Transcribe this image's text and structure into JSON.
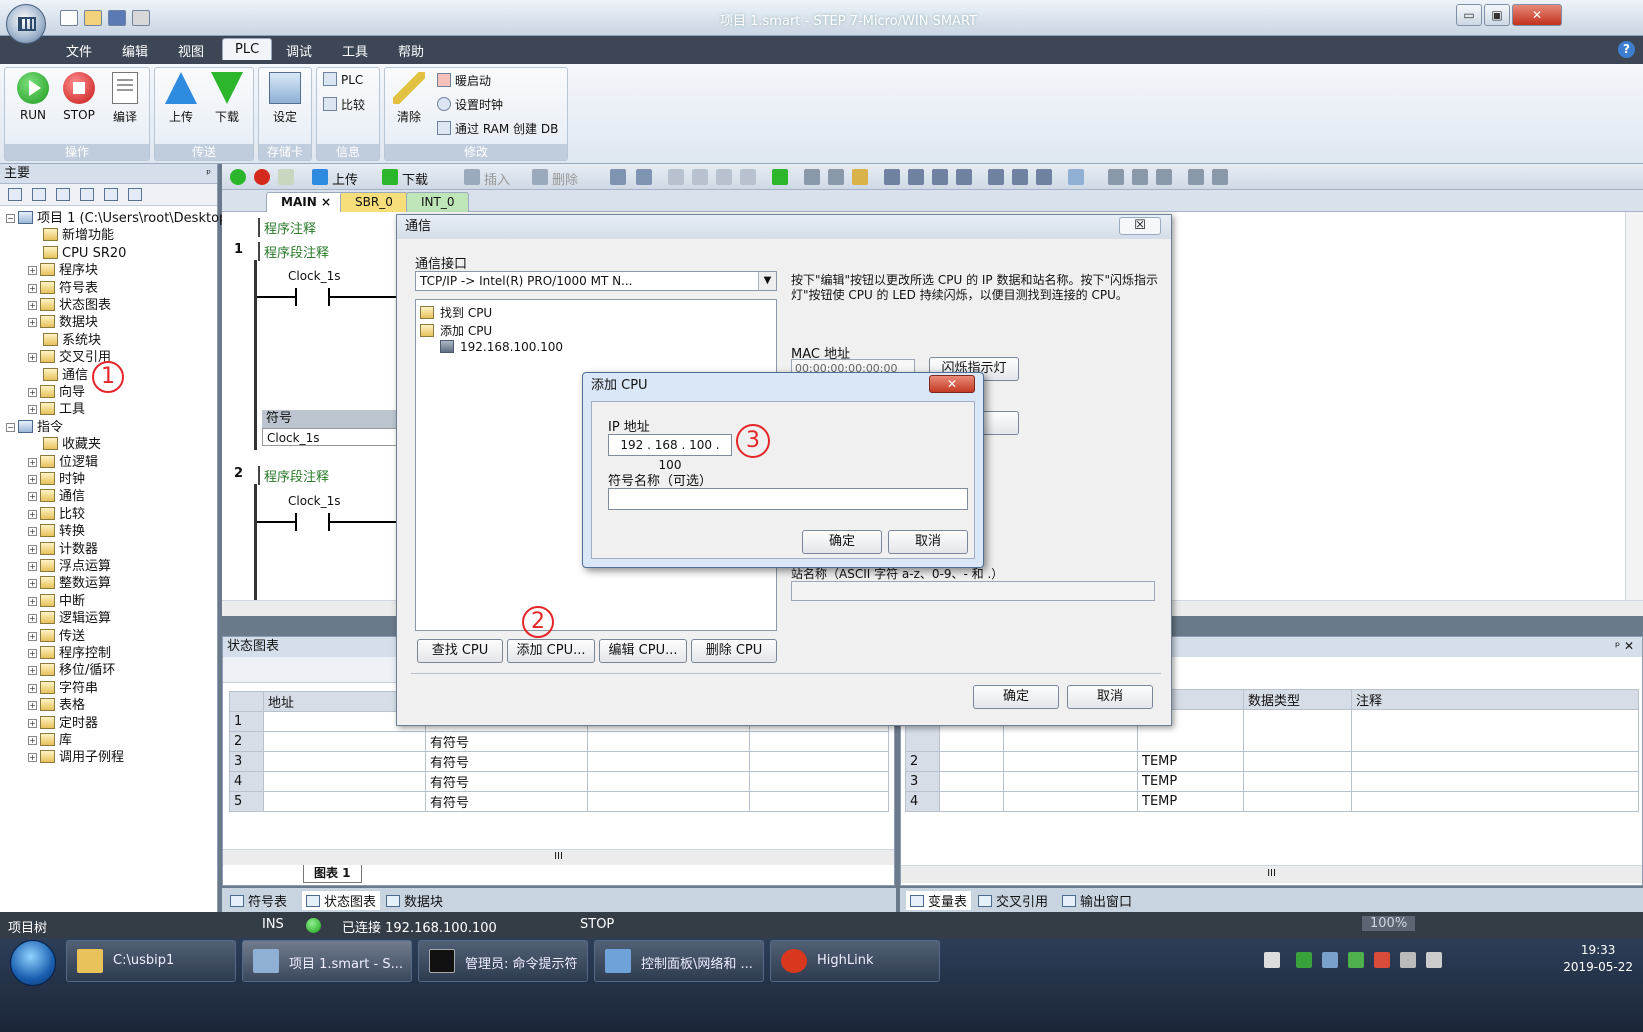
{
  "window": {
    "title": "项目 1.smart - STEP 7-Micro/WIN SMART",
    "minimize": "▭",
    "restore": "▣",
    "close": "✕"
  },
  "menu": {
    "items": [
      "文件",
      "编辑",
      "视图",
      "PLC",
      "调试",
      "工具",
      "帮助"
    ],
    "active": "PLC",
    "help_icon": "?"
  },
  "ribbon": {
    "groups": [
      {
        "label": "操作",
        "buttons": [
          "RUN",
          "STOP",
          "编译"
        ]
      },
      {
        "label": "传送",
        "buttons": [
          "上传",
          "下载"
        ]
      },
      {
        "label": "存储卡",
        "buttons": [
          "设定"
        ]
      },
      {
        "label": "信息",
        "buttons": [
          "PLC",
          "比较"
        ]
      },
      {
        "label": "修改",
        "buttons": [
          "清除",
          "暖启动",
          "设置时钟",
          "通过 RAM 创建 DB"
        ]
      }
    ]
  },
  "left_panel": {
    "title": "主要",
    "pin": "ᵖ",
    "tree": [
      {
        "label": "项目 1 (C:\\Users\\root\\Desktop)",
        "level": 0,
        "expander": "−"
      },
      {
        "label": "新增功能",
        "level": 1,
        "expander": ""
      },
      {
        "label": "CPU SR20",
        "level": 1,
        "expander": ""
      },
      {
        "label": "程序块",
        "level": 1,
        "expander": "+"
      },
      {
        "label": "符号表",
        "level": 1,
        "expander": "+"
      },
      {
        "label": "状态图表",
        "level": 1,
        "expander": "+"
      },
      {
        "label": "数据块",
        "level": 1,
        "expander": "+"
      },
      {
        "label": "系统块",
        "level": 1,
        "expander": ""
      },
      {
        "label": "交叉引用",
        "level": 1,
        "expander": "+"
      },
      {
        "label": "通信",
        "level": 1,
        "expander": ""
      },
      {
        "label": "向导",
        "level": 1,
        "expander": "+"
      },
      {
        "label": "工具",
        "level": 1,
        "expander": "+"
      },
      {
        "label": "指令",
        "level": 0,
        "expander": "−"
      },
      {
        "label": "收藏夹",
        "level": 1,
        "expander": ""
      },
      {
        "label": "位逻辑",
        "level": 1,
        "expander": "+"
      },
      {
        "label": "时钟",
        "level": 1,
        "expander": "+"
      },
      {
        "label": "通信",
        "level": 1,
        "expander": "+"
      },
      {
        "label": "比较",
        "level": 1,
        "expander": "+"
      },
      {
        "label": "转换",
        "level": 1,
        "expander": "+"
      },
      {
        "label": "计数器",
        "level": 1,
        "expander": "+"
      },
      {
        "label": "浮点运算",
        "level": 1,
        "expander": "+"
      },
      {
        "label": "整数运算",
        "level": 1,
        "expander": "+"
      },
      {
        "label": "中断",
        "level": 1,
        "expander": "+"
      },
      {
        "label": "逻辑运算",
        "level": 1,
        "expander": "+"
      },
      {
        "label": "传送",
        "level": 1,
        "expander": "+"
      },
      {
        "label": "程序控制",
        "level": 1,
        "expander": "+"
      },
      {
        "label": "移位/循环",
        "level": 1,
        "expander": "+"
      },
      {
        "label": "字符串",
        "level": 1,
        "expander": "+"
      },
      {
        "label": "表格",
        "level": 1,
        "expander": "+"
      },
      {
        "label": "定时器",
        "level": 1,
        "expander": "+"
      },
      {
        "label": "库",
        "level": 1,
        "expander": "+"
      },
      {
        "label": "调用子例程",
        "level": 1,
        "expander": "+"
      }
    ]
  },
  "editor_toolbar": {
    "upload": "上传",
    "download": "下载",
    "insert": "插入",
    "delete": "删除"
  },
  "editor_tabs": [
    "MAIN",
    "SBR_0",
    "INT_0"
  ],
  "editor_tab_close": "×",
  "editor": {
    "program_comment": "程序注释",
    "networks": [
      {
        "number": "1",
        "comment": "程序段注释",
        "contact": "Clock_1s"
      },
      {
        "number": "2",
        "comment": "程序段注释",
        "contact": "Clock_1s"
      }
    ],
    "symbol_header": "符号",
    "symbol_value": "Clock_1s"
  },
  "status_chart": {
    "title": "状态图表",
    "columns": [
      "",
      "地址",
      "",
      "",
      ""
    ],
    "rows": [
      {
        "n": "1",
        "format": ""
      },
      {
        "n": "2",
        "format": "有符号"
      },
      {
        "n": "3",
        "format": "有符号"
      },
      {
        "n": "4",
        "format": "有符号"
      },
      {
        "n": "5",
        "format": "有符号"
      }
    ],
    "sheet_tab": "图表 1",
    "scroll_grip": "III"
  },
  "variable_table": {
    "columns": [
      "",
      "",
      "",
      "型",
      "数据类型",
      "注释"
    ],
    "rows": [
      {
        "n": "2",
        "type": "TEMP"
      },
      {
        "n": "3",
        "type": "TEMP"
      },
      {
        "n": "4",
        "type": "TEMP"
      }
    ],
    "scroll_grip": "III",
    "panel_controls": "ᵖ ✕"
  },
  "bottom_tabs_left": [
    "符号表",
    "状态图表",
    "数据块"
  ],
  "bottom_tabs_right": [
    "变量表",
    "交叉引用",
    "输出窗口"
  ],
  "status_bar": {
    "tree_label": "项目树",
    "mode": "INS",
    "connection": "已连接 192.168.100.100",
    "plc_state": "STOP",
    "zoom": "100%"
  },
  "comm_dialog": {
    "title": "通信",
    "close": "☒",
    "interface_label": "通信接口",
    "interface_value": "TCP/IP -> Intel(R) PRO/1000 MT N...",
    "tree": [
      {
        "label": "找到 CPU",
        "type": "folder"
      },
      {
        "label": "添加 CPU",
        "type": "folder"
      },
      {
        "label": "192.168.100.100",
        "type": "device"
      }
    ],
    "description": "按下\"编辑\"按钮以更改所选 CPU 的 IP 数据和站名称。按下\"闪烁指示灯\"按钮使 CPU 的 LED 持续闪烁，以便目测找到连接的 CPU。",
    "mac_label": "MAC 地址",
    "mac_value": "00:00:00:00:00:00",
    "blink_button": "闪烁指示灯",
    "station_label": "站名称（ASCII 字符 a-z、0-9、- 和 .）",
    "buttons": [
      "查找 CPU",
      "添加 CPU...",
      "编辑 CPU...",
      "删除 CPU"
    ],
    "ok": "确定",
    "cancel": "取消"
  },
  "add_cpu_dialog": {
    "title": "添加 CPU",
    "close": "✕",
    "ip_label": "IP 地址",
    "ip_value": "192 . 168 . 100 . 100",
    "name_label": "符号名称（可选）",
    "name_value": "",
    "ok": "确定",
    "cancel": "取消"
  },
  "annotations": [
    "1",
    "2",
    "3"
  ],
  "taskbar": {
    "tasks": [
      "C:\\usbip1",
      "项目 1.smart - S...",
      "管理员: 命令提示符",
      "控制面板\\网络和 ...",
      "HighLink"
    ],
    "time": "19:33",
    "date": "2019-05-22"
  },
  "colors": {
    "accent": "#2f8be0",
    "annotation": "#e4262a",
    "connected": "#1a9f1a"
  }
}
